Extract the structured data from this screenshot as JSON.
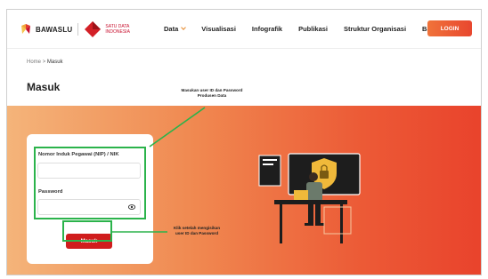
{
  "header": {
    "brand": "BAWASLU",
    "satu_data_line1": "SATU DATA",
    "satu_data_line2": "INDONESIA",
    "nav": [
      {
        "label": "Data",
        "has_dropdown": true
      },
      {
        "label": "Visualisasi",
        "has_dropdown": false
      },
      {
        "label": "Infografik",
        "has_dropdown": false
      },
      {
        "label": "Publikasi",
        "has_dropdown": false
      },
      {
        "label": "Struktur Organisasi",
        "has_dropdown": false
      },
      {
        "label": "Bantuan",
        "has_dropdown": true
      }
    ],
    "login_label": "LOGIN"
  },
  "breadcrumb": {
    "home": "Home",
    "sep": ">",
    "current": "Masuk"
  },
  "page_title": "Masuk",
  "form": {
    "nip_label": "Nomor Induk Pegawai (NIP) / NIK",
    "nip_value": "",
    "password_label": "Password",
    "password_value": "",
    "submit_label": "Masuk"
  },
  "annotations": {
    "top_line1": "Masukan user ID dan Password",
    "top_line2": "Produsen Data",
    "bottom_line1": "Klik setelah mengisikan",
    "bottom_line2": "user ID dan Password"
  },
  "colors": {
    "accent": "#e8472f",
    "submit": "#d01d1d",
    "annotation": "#2bb34b"
  }
}
